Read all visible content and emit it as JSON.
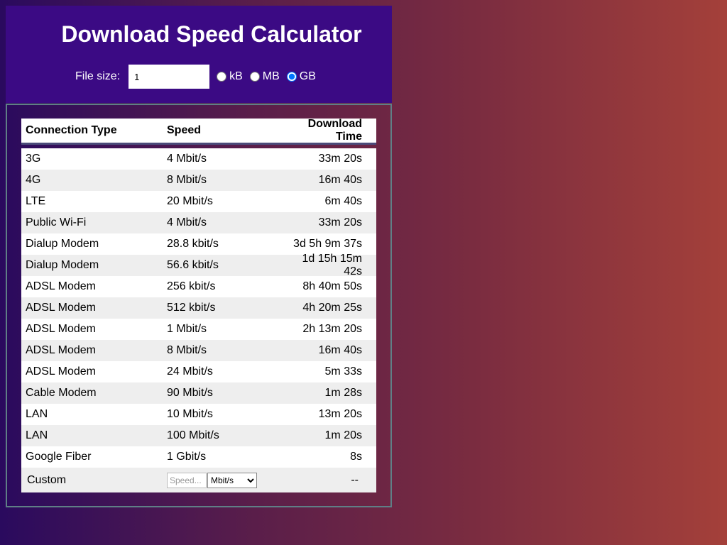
{
  "header": {
    "title": "Download Speed Calculator",
    "file_size_label": "File size:",
    "file_size_value": "1",
    "units": [
      {
        "label": "kB",
        "checked": false
      },
      {
        "label": "MB",
        "checked": false
      },
      {
        "label": "GB",
        "checked": true
      }
    ]
  },
  "table": {
    "columns": [
      "Connection Type",
      "Speed",
      "Download Time"
    ],
    "rows": [
      {
        "type": "3G",
        "speed": "4 Mbit/s",
        "time": "33m 20s"
      },
      {
        "type": "4G",
        "speed": "8 Mbit/s",
        "time": "16m 40s"
      },
      {
        "type": "LTE",
        "speed": "20 Mbit/s",
        "time": "6m 40s"
      },
      {
        "type": "Public Wi-Fi",
        "speed": "4 Mbit/s",
        "time": "33m 20s"
      },
      {
        "type": "Dialup Modem",
        "speed": "28.8 kbit/s",
        "time": "3d 5h 9m 37s"
      },
      {
        "type": "Dialup Modem",
        "speed": "56.6 kbit/s",
        "time": "1d 15h 15m 42s"
      },
      {
        "type": "ADSL Modem",
        "speed": "256 kbit/s",
        "time": "8h 40m 50s"
      },
      {
        "type": "ADSL Modem",
        "speed": "512 kbit/s",
        "time": "4h 20m 25s"
      },
      {
        "type": "ADSL Modem",
        "speed": "1 Mbit/s",
        "time": "2h 13m 20s"
      },
      {
        "type": "ADSL Modem",
        "speed": "8 Mbit/s",
        "time": "16m 40s"
      },
      {
        "type": "ADSL Modem",
        "speed": "24 Mbit/s",
        "time": "5m 33s"
      },
      {
        "type": "Cable Modem",
        "speed": "90 Mbit/s",
        "time": "1m 28s"
      },
      {
        "type": "LAN",
        "speed": "10 Mbit/s",
        "time": "13m 20s"
      },
      {
        "type": "LAN",
        "speed": "100 Mbit/s",
        "time": "1m 20s"
      },
      {
        "type": "Google Fiber",
        "speed": "1 Gbit/s",
        "time": "8s"
      }
    ],
    "custom": {
      "label": "Custom",
      "speed_placeholder": "Speed...",
      "unit_selected": "Mbit/s",
      "time": "--"
    }
  },
  "colors": {
    "header_bg": "#3b0a84",
    "panel_border": "#5f7f86",
    "row_alt": "#eeeeee",
    "header_rule": "#4b4b7a"
  }
}
